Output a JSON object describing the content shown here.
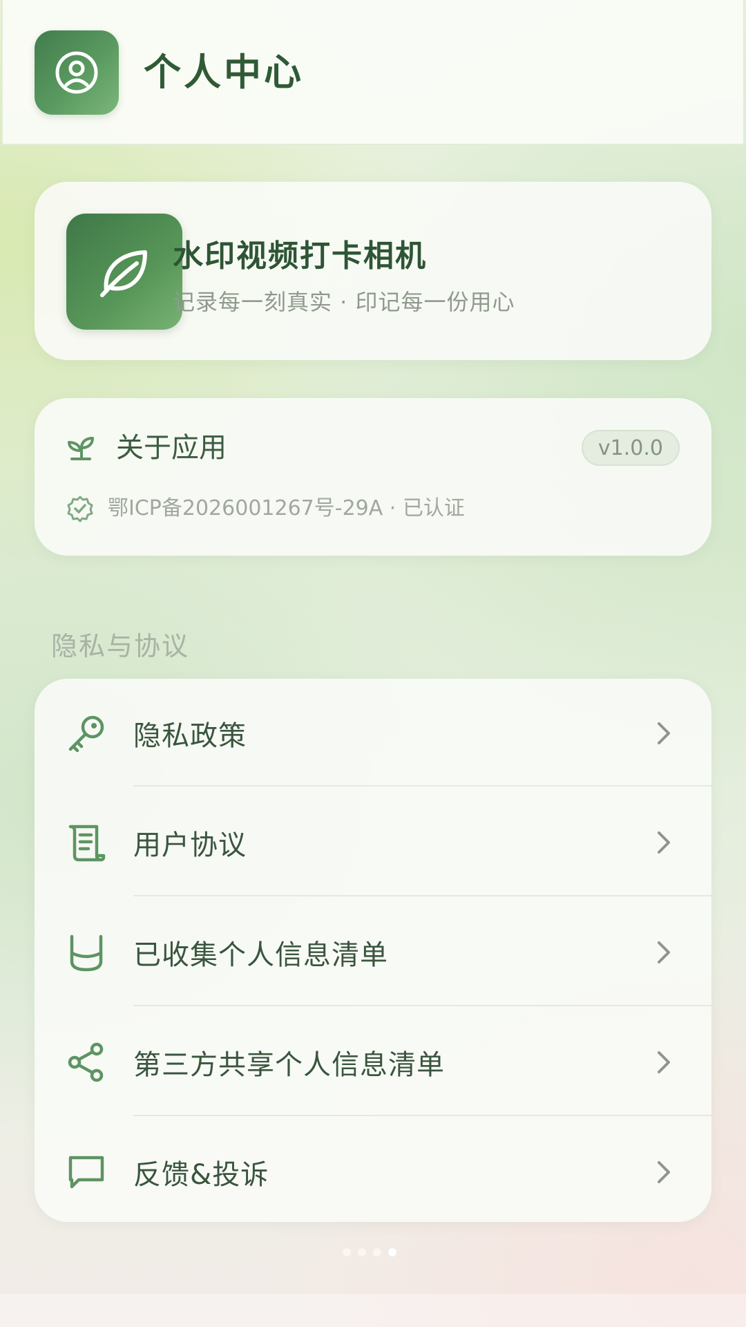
{
  "header": {
    "title": "个人中心",
    "icon": "user-circle-icon"
  },
  "app_card": {
    "name": "水印视频打卡相机",
    "slogan": "记录每一刻真实 · 印记每一份用心",
    "logo_icon": "leaf-icon"
  },
  "about": {
    "label": "关于应用",
    "icon": "sprout-icon",
    "version": "v1.0.0",
    "icp_text": "鄂ICP备2026001267号-29A · 已认证",
    "icp_icon": "check-badge-icon"
  },
  "privacy_section": {
    "title": "隐私与协议",
    "items": [
      {
        "label": "隐私政策",
        "icon": "key-icon"
      },
      {
        "label": "用户协议",
        "icon": "scroll-icon"
      },
      {
        "label": "已收集个人信息清单",
        "icon": "container-icon"
      },
      {
        "label": "第三方共享个人信息清单",
        "icon": "share-icon"
      },
      {
        "label": "反馈&投诉",
        "icon": "message-icon"
      }
    ]
  },
  "pagination": {
    "total": 4,
    "active": 4
  },
  "colors": {
    "brand_green": "#4a8a52",
    "text_dark_green": "#2f5a36",
    "muted_text": "#a0a89e"
  }
}
